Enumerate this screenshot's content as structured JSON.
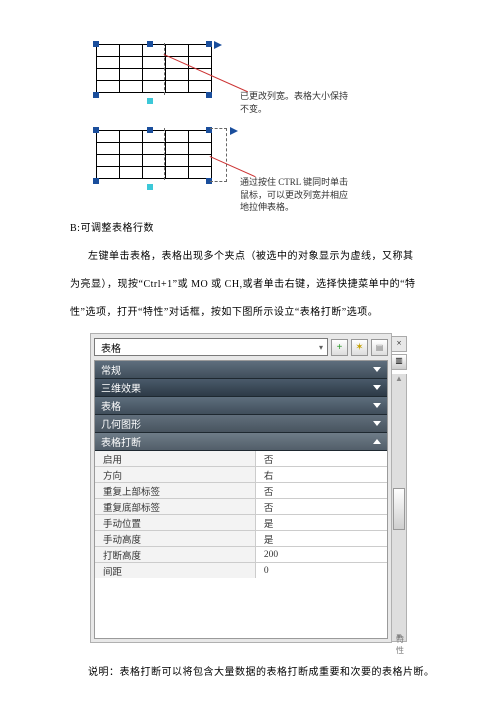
{
  "callout1": "已更改列宽。表格大小保持不变。",
  "callout2": "通过按住 CTRL 键同时单击鼠标，可以更改列宽并相应地拉伸表格。",
  "sectionB": "B:可调整表格行数",
  "para1": "左键单击表格，表格出现多个夹点（被选中的对象显示为虚线，又称其",
  "para2": "为亮显），现按“Ctrl+1”或 MO 或 CH,或者单击右键，选择快捷菜单中的“特",
  "para3": "性”选项，打开“特性”对话框，按如下图所示设立“表格打断”选项。",
  "panel_selector": "表格",
  "sections": {
    "s1": "常规",
    "s2": "三维效果",
    "s3": "表格",
    "s4": "几何图形",
    "s5": "表格打断"
  },
  "props": [
    {
      "k": "启用",
      "v": "否"
    },
    {
      "k": "方向",
      "v": "右"
    },
    {
      "k": "重复上部标签",
      "v": "否"
    },
    {
      "k": "重复底部标签",
      "v": "否"
    },
    {
      "k": "手动位置",
      "v": "是"
    },
    {
      "k": "手动高度",
      "v": "是"
    },
    {
      "k": "打断高度",
      "v": "200"
    },
    {
      "k": "间距",
      "v": "0"
    }
  ],
  "note": "说明：表格打断可以将包含大量数据的表格打断成重要和次要的表格片断。",
  "close_x": "×",
  "snap_icon": "▥",
  "sb_label": "特性",
  "scroll_up": "▲",
  "scroll_dn": "▼"
}
